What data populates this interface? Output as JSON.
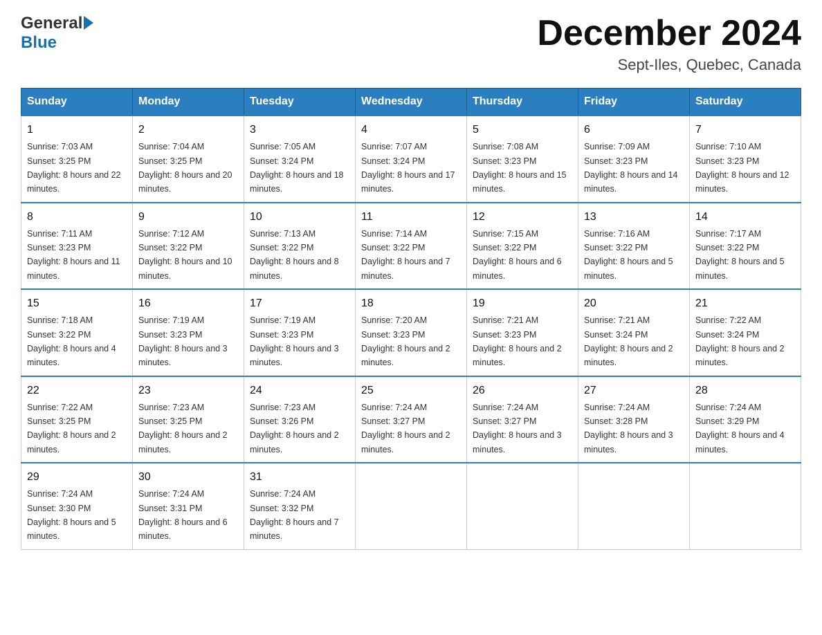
{
  "logo": {
    "line1": "General",
    "line2": "Blue"
  },
  "title": "December 2024",
  "subtitle": "Sept-Iles, Quebec, Canada",
  "days_of_week": [
    "Sunday",
    "Monday",
    "Tuesday",
    "Wednesday",
    "Thursday",
    "Friday",
    "Saturday"
  ],
  "weeks": [
    [
      {
        "day": "1",
        "sunrise": "7:03 AM",
        "sunset": "3:25 PM",
        "daylight": "8 hours and 22 minutes."
      },
      {
        "day": "2",
        "sunrise": "7:04 AM",
        "sunset": "3:25 PM",
        "daylight": "8 hours and 20 minutes."
      },
      {
        "day": "3",
        "sunrise": "7:05 AM",
        "sunset": "3:24 PM",
        "daylight": "8 hours and 18 minutes."
      },
      {
        "day": "4",
        "sunrise": "7:07 AM",
        "sunset": "3:24 PM",
        "daylight": "8 hours and 17 minutes."
      },
      {
        "day": "5",
        "sunrise": "7:08 AM",
        "sunset": "3:23 PM",
        "daylight": "8 hours and 15 minutes."
      },
      {
        "day": "6",
        "sunrise": "7:09 AM",
        "sunset": "3:23 PM",
        "daylight": "8 hours and 14 minutes."
      },
      {
        "day": "7",
        "sunrise": "7:10 AM",
        "sunset": "3:23 PM",
        "daylight": "8 hours and 12 minutes."
      }
    ],
    [
      {
        "day": "8",
        "sunrise": "7:11 AM",
        "sunset": "3:23 PM",
        "daylight": "8 hours and 11 minutes."
      },
      {
        "day": "9",
        "sunrise": "7:12 AM",
        "sunset": "3:22 PM",
        "daylight": "8 hours and 10 minutes."
      },
      {
        "day": "10",
        "sunrise": "7:13 AM",
        "sunset": "3:22 PM",
        "daylight": "8 hours and 8 minutes."
      },
      {
        "day": "11",
        "sunrise": "7:14 AM",
        "sunset": "3:22 PM",
        "daylight": "8 hours and 7 minutes."
      },
      {
        "day": "12",
        "sunrise": "7:15 AM",
        "sunset": "3:22 PM",
        "daylight": "8 hours and 6 minutes."
      },
      {
        "day": "13",
        "sunrise": "7:16 AM",
        "sunset": "3:22 PM",
        "daylight": "8 hours and 5 minutes."
      },
      {
        "day": "14",
        "sunrise": "7:17 AM",
        "sunset": "3:22 PM",
        "daylight": "8 hours and 5 minutes."
      }
    ],
    [
      {
        "day": "15",
        "sunrise": "7:18 AM",
        "sunset": "3:22 PM",
        "daylight": "8 hours and 4 minutes."
      },
      {
        "day": "16",
        "sunrise": "7:19 AM",
        "sunset": "3:23 PM",
        "daylight": "8 hours and 3 minutes."
      },
      {
        "day": "17",
        "sunrise": "7:19 AM",
        "sunset": "3:23 PM",
        "daylight": "8 hours and 3 minutes."
      },
      {
        "day": "18",
        "sunrise": "7:20 AM",
        "sunset": "3:23 PM",
        "daylight": "8 hours and 2 minutes."
      },
      {
        "day": "19",
        "sunrise": "7:21 AM",
        "sunset": "3:23 PM",
        "daylight": "8 hours and 2 minutes."
      },
      {
        "day": "20",
        "sunrise": "7:21 AM",
        "sunset": "3:24 PM",
        "daylight": "8 hours and 2 minutes."
      },
      {
        "day": "21",
        "sunrise": "7:22 AM",
        "sunset": "3:24 PM",
        "daylight": "8 hours and 2 minutes."
      }
    ],
    [
      {
        "day": "22",
        "sunrise": "7:22 AM",
        "sunset": "3:25 PM",
        "daylight": "8 hours and 2 minutes."
      },
      {
        "day": "23",
        "sunrise": "7:23 AM",
        "sunset": "3:25 PM",
        "daylight": "8 hours and 2 minutes."
      },
      {
        "day": "24",
        "sunrise": "7:23 AM",
        "sunset": "3:26 PM",
        "daylight": "8 hours and 2 minutes."
      },
      {
        "day": "25",
        "sunrise": "7:24 AM",
        "sunset": "3:27 PM",
        "daylight": "8 hours and 2 minutes."
      },
      {
        "day": "26",
        "sunrise": "7:24 AM",
        "sunset": "3:27 PM",
        "daylight": "8 hours and 3 minutes."
      },
      {
        "day": "27",
        "sunrise": "7:24 AM",
        "sunset": "3:28 PM",
        "daylight": "8 hours and 3 minutes."
      },
      {
        "day": "28",
        "sunrise": "7:24 AM",
        "sunset": "3:29 PM",
        "daylight": "8 hours and 4 minutes."
      }
    ],
    [
      {
        "day": "29",
        "sunrise": "7:24 AM",
        "sunset": "3:30 PM",
        "daylight": "8 hours and 5 minutes."
      },
      {
        "day": "30",
        "sunrise": "7:24 AM",
        "sunset": "3:31 PM",
        "daylight": "8 hours and 6 minutes."
      },
      {
        "day": "31",
        "sunrise": "7:24 AM",
        "sunset": "3:32 PM",
        "daylight": "8 hours and 7 minutes."
      },
      null,
      null,
      null,
      null
    ]
  ]
}
